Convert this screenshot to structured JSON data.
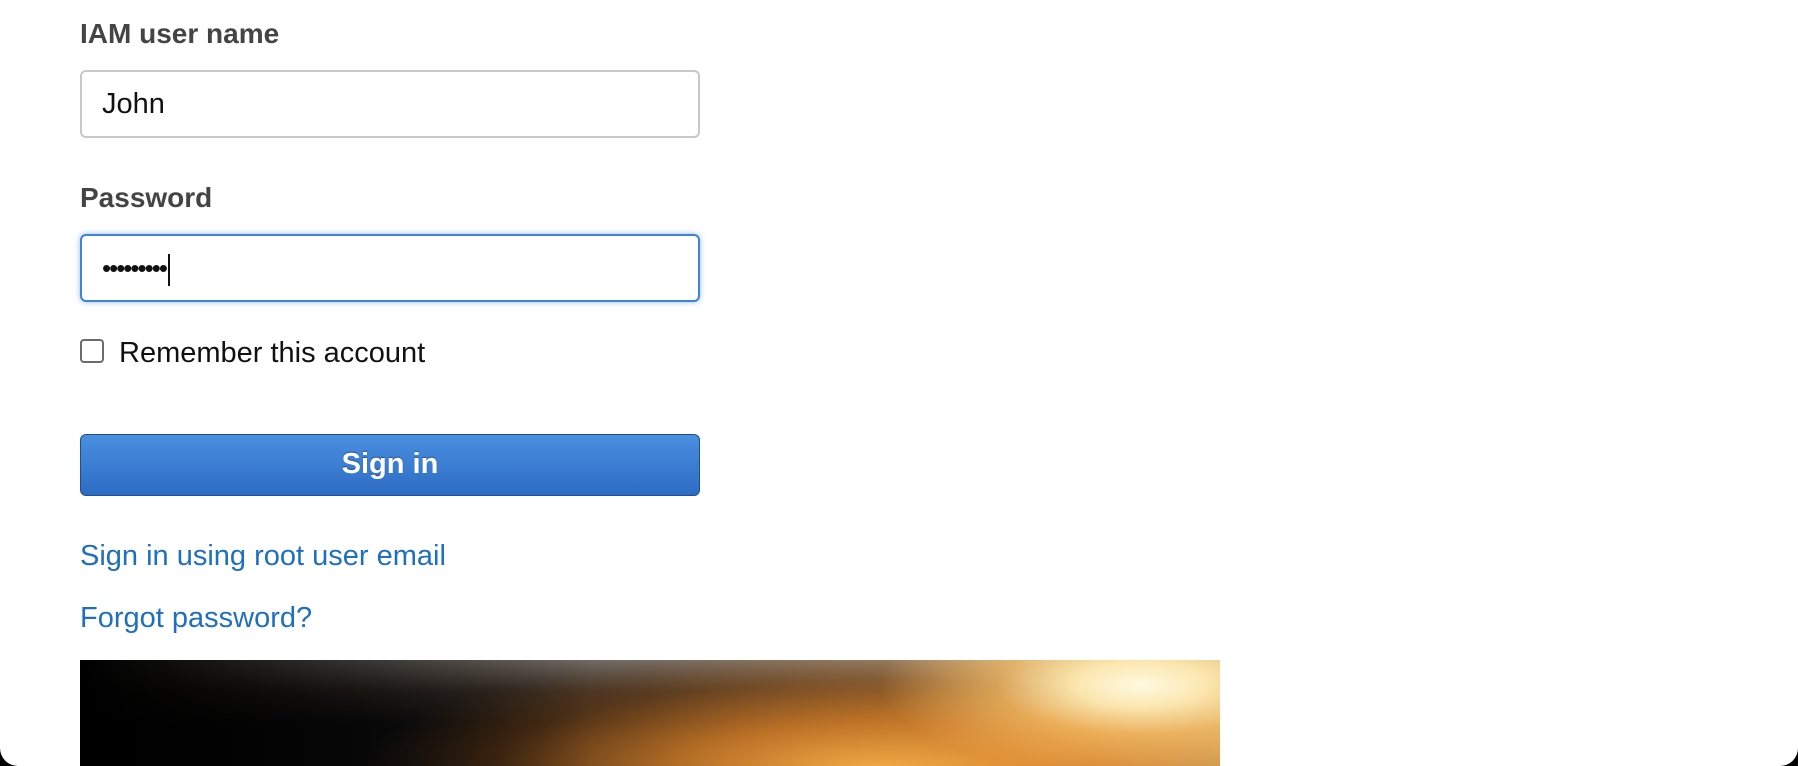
{
  "login_form": {
    "username_label": "IAM user name",
    "username_value": "John",
    "password_label": "Password",
    "password_value": "•••••••••",
    "remember_label": "Remember this account",
    "remember_checked": false,
    "signin_label": "Sign in",
    "root_link": "Sign in using root user email",
    "forgot_link": "Forgot password?"
  },
  "colors": {
    "button": "#2d6cc4",
    "link": "#1f6fbf",
    "focus_border": "#3d83d6"
  }
}
